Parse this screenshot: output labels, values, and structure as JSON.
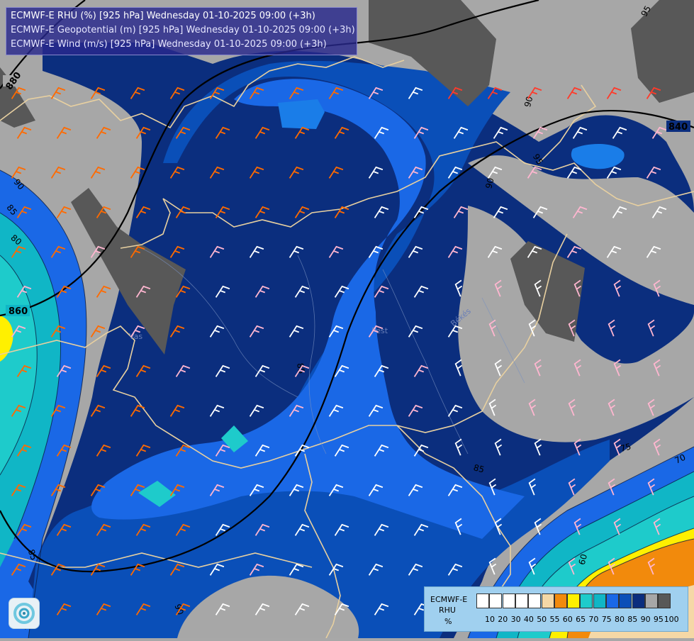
{
  "header": {
    "line1": "ECMWF-E RHU (%) [925 hPa] Wednesday 01-10-2025 09:00 (+3h)",
    "line2": "ECMWF-E Geopotential (m) [925 hPa] Wednesday 01-10-2025 09:00 (+3h)",
    "line3": "ECMWF-E Wind (m/s) [925 hPa] Wednesday 01-10-2025 09:00 (+3h)"
  },
  "legend": {
    "model": "ECMWF-E",
    "variable": "RHU",
    "unit": "%",
    "ticks": [
      "10",
      "20",
      "30",
      "40",
      "50",
      "55",
      "60",
      "65",
      "70",
      "75",
      "80",
      "85",
      "90",
      "95",
      "100"
    ],
    "colors": [
      "#ffffff",
      "#ffffff",
      "#ffffff",
      "#ffffff",
      "#ffffff",
      "#f5d8a6",
      "#f28a0c",
      "#fff000",
      "#1ecbcb",
      "#10b6c6",
      "#1a68e6",
      "#0a4fb8",
      "#0b2e7e",
      "#a7a7a7",
      "#585858"
    ]
  },
  "colors": {
    "rh_below_60": "#e8e8e8",
    "rh_60": "#f28a0c",
    "rh_65": "#fff000",
    "rh_70": "#1ecbcb",
    "rh_75": "#10b6c6",
    "rh_80": "#1a68e6",
    "rh_85": "#0a4fb8",
    "rh_90": "#0b2e7e",
    "rh_95": "#a7a7a7",
    "rh_100": "#585858",
    "geopotential_isoline": "#000000",
    "border": "#e8d0a0"
  },
  "geopotential_labels": [
    "880",
    "860",
    "840"
  ],
  "rhu_contour_labels": [
    "95",
    "90",
    "85",
    "80",
    "75",
    "70",
    "60",
    "85",
    "85",
    "85",
    "90",
    "85",
    "90",
    "95",
    "90"
  ],
  "places": [
    "Pest",
    "Békés",
    "Vas"
  ],
  "icons": [
    "logo-icon"
  ]
}
